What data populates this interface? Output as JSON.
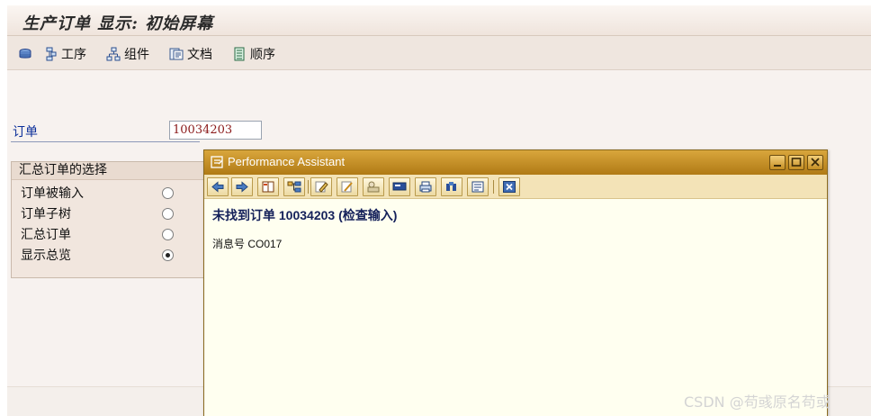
{
  "window": {
    "title": "生产订单 显示: 初始屏幕"
  },
  "toolbar": {
    "items": [
      {
        "label": "",
        "icon": "coin-stack-icon"
      },
      {
        "label": "工序",
        "icon": "operation-icon"
      },
      {
        "label": "组件",
        "icon": "component-tree-icon"
      },
      {
        "label": "文档",
        "icon": "document-icon"
      },
      {
        "label": "顺序",
        "icon": "sequence-icon"
      }
    ]
  },
  "form": {
    "order_label": "订单",
    "order_value": "10034203",
    "group": {
      "title": "汇总订单的选择",
      "options": [
        {
          "label": "订单被输入",
          "checked": false
        },
        {
          "label": "订单子树",
          "checked": false
        },
        {
          "label": "汇总订单",
          "checked": false
        },
        {
          "label": "显示总览",
          "checked": true
        }
      ]
    }
  },
  "dialog": {
    "title": "Performance Assistant",
    "heading": "未找到订单 10034203 (检查输入)",
    "message": "消息号 CO017",
    "toolbar_icons": [
      "back-arrow-icon",
      "forward-arrow-icon",
      "book-icon",
      "tree-structure-icon",
      "edit-pencil-icon",
      "technical-info-icon",
      "settings-icon",
      "display-mode-icon",
      "print-icon",
      "find-icon",
      "page-layout-icon",
      "close-window-icon"
    ]
  },
  "watermark": "CSDN @苟彧原名苟或",
  "colors": {
    "accent": "#c08a1f",
    "label_blue": "#0b2f9a",
    "value_red": "#8b1a1a"
  }
}
